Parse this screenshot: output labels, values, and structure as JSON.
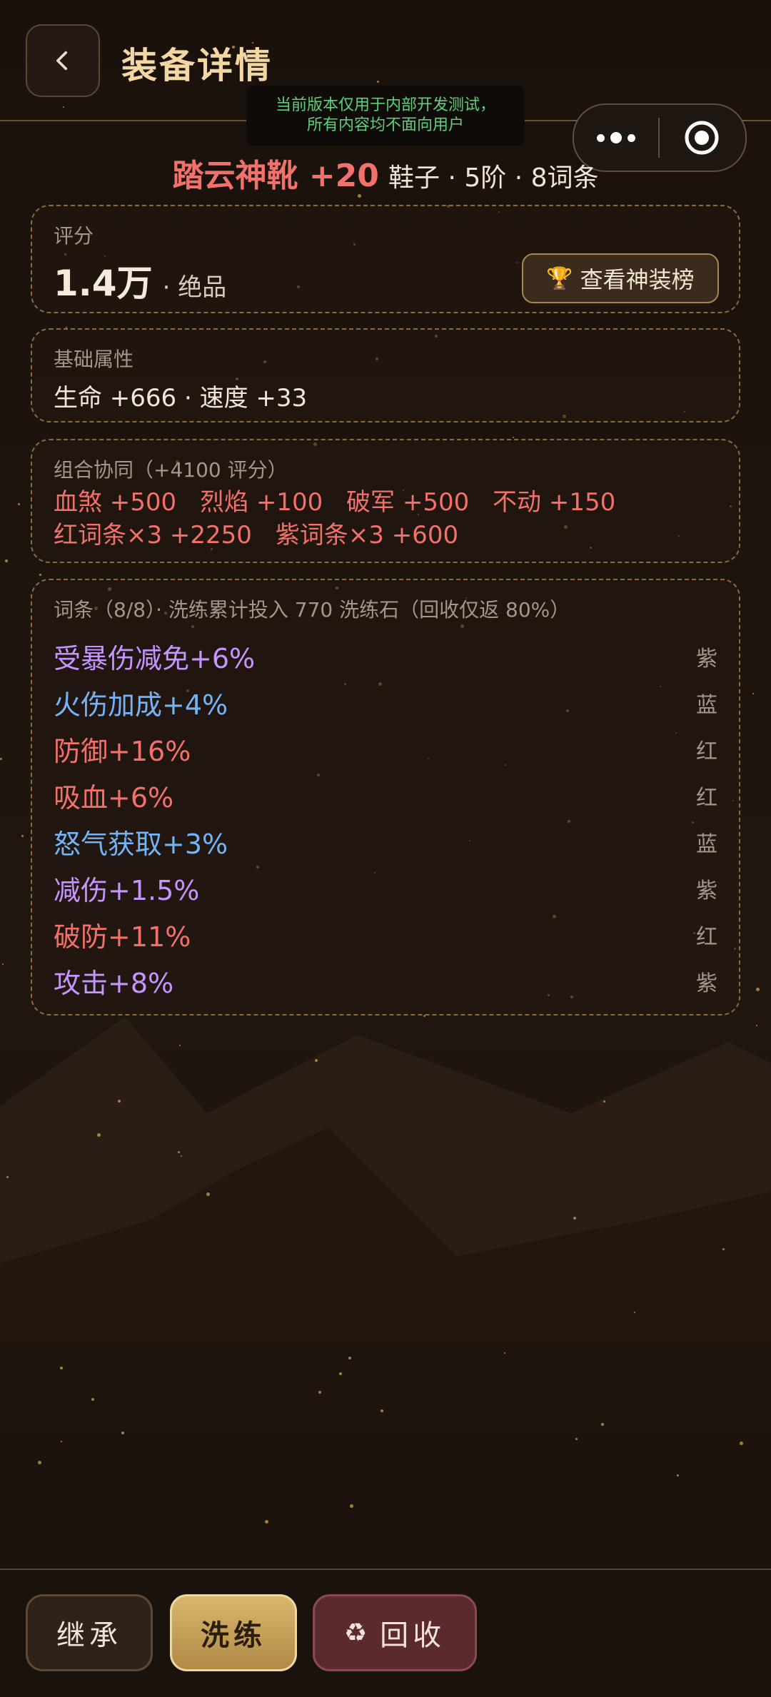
{
  "header": {
    "title": "装备详情",
    "notice": [
      "当前版本仅用于内部开发测试，",
      "所有内容均不面向用户"
    ]
  },
  "equipment": {
    "name": "踏云神靴 +20",
    "meta": "鞋子 · 5阶 · 8词条"
  },
  "score": {
    "label": "评分",
    "value": "1.4万",
    "grade": "· 绝品",
    "rank_button": "查看神装榜"
  },
  "base": {
    "label": "基础属性",
    "text": "生命 +666 · 速度 +33"
  },
  "combo": {
    "label": "组合协同（+4100 评分）",
    "items": [
      "血煞 +500",
      "烈焰 +100",
      "破军 +500",
      "不动 +150",
      "红词条×3 +2250",
      "紫词条×3 +600"
    ]
  },
  "affixes": {
    "label": "词条（8/8）· 洗练累计投入 770 洗练石（回收仅返 80%）",
    "items": [
      {
        "name": "受暴伤减免+6%",
        "tag": "紫",
        "color": "#c694ff"
      },
      {
        "name": "火伤加成+4%",
        "tag": "蓝",
        "color": "#73b3f6"
      },
      {
        "name": "防御+16%",
        "tag": "红",
        "color": "#f2716a"
      },
      {
        "name": "吸血+6%",
        "tag": "红",
        "color": "#f2716a"
      },
      {
        "name": "怒气获取+3%",
        "tag": "蓝",
        "color": "#73b3f6"
      },
      {
        "name": "减伤+1.5%",
        "tag": "紫",
        "color": "#c694ff"
      },
      {
        "name": "破防+11%",
        "tag": "红",
        "color": "#f2716a"
      },
      {
        "name": "攻击+8%",
        "tag": "紫",
        "color": "#c694ff"
      }
    ]
  },
  "actions": {
    "inherit": "继承",
    "refine": "洗练",
    "recycle": "回收"
  }
}
